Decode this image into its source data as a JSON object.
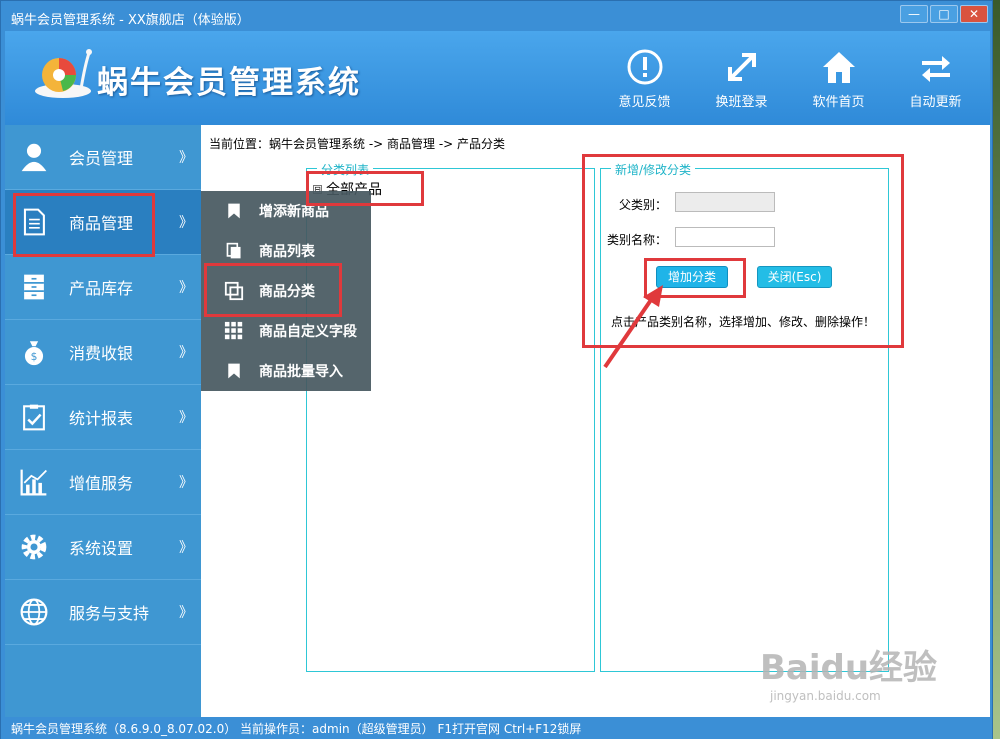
{
  "window": {
    "title": "蜗牛会员管理系统 - XX旗舰店（体验版）",
    "controls": [
      "—",
      "□",
      "✕"
    ]
  },
  "header": {
    "app_title": "蜗牛会员管理系统",
    "toolbar": [
      {
        "label": "意见反馈",
        "icon": "feedback-icon"
      },
      {
        "label": "换班登录",
        "icon": "switch-shift-icon"
      },
      {
        "label": "软件首页",
        "icon": "home-icon"
      },
      {
        "label": "自动更新",
        "icon": "auto-update-icon"
      }
    ]
  },
  "sidebar": {
    "items": [
      {
        "label": "会员管理",
        "icon": "member-icon"
      },
      {
        "label": "商品管理",
        "icon": "document-icon"
      },
      {
        "label": "产品库存",
        "icon": "cabinet-icon"
      },
      {
        "label": "消费收银",
        "icon": "money-bag-icon"
      },
      {
        "label": "统计报表",
        "icon": "clipboard-icon"
      },
      {
        "label": "增值服务",
        "icon": "chart-icon"
      },
      {
        "label": "系统设置",
        "icon": "gear-icon"
      },
      {
        "label": "服务与支持",
        "icon": "globe-icon"
      }
    ],
    "chevron": "》"
  },
  "submenu": {
    "items": [
      {
        "label": "增添新商品",
        "icon": "bookmark-icon"
      },
      {
        "label": "商品列表",
        "icon": "list-icon"
      },
      {
        "label": "商品分类",
        "icon": "category-icon"
      },
      {
        "label": "商品自定义字段",
        "icon": "grid-icon"
      },
      {
        "label": "商品批量导入",
        "icon": "import-icon"
      }
    ]
  },
  "main": {
    "breadcrumb": "当前位置：蜗牛会员管理系统 -> 商品管理 -> 产品分类",
    "category_list": {
      "legend": "分类列表",
      "root_node": "全部产品",
      "toggle": "⊟"
    },
    "edit_panel": {
      "legend": "新增/修改分类",
      "parent_label": "父类别：",
      "parent_value": "",
      "name_label": "类别名称：",
      "name_value": "",
      "add_button": "增加分类",
      "close_button": "关闭(Esc)",
      "hint": "点击产品类别名称，选择增加、修改、删除操作！"
    }
  },
  "statusbar": {
    "text": "蜗牛会员管理系统（8.6.9.0_8.07.02.0） 当前操作员：admin（超级管理员） F1打开官网 Ctrl+F12锁屏"
  },
  "watermark": {
    "main": "Baidu经验",
    "sub": "jingyan.baidu.com"
  },
  "colors": {
    "header_blue": "#3b8fd6",
    "sidebar_blue": "#3f97d2",
    "accent_cyan": "#1fb4e8",
    "highlight_red": "#e0393c"
  }
}
